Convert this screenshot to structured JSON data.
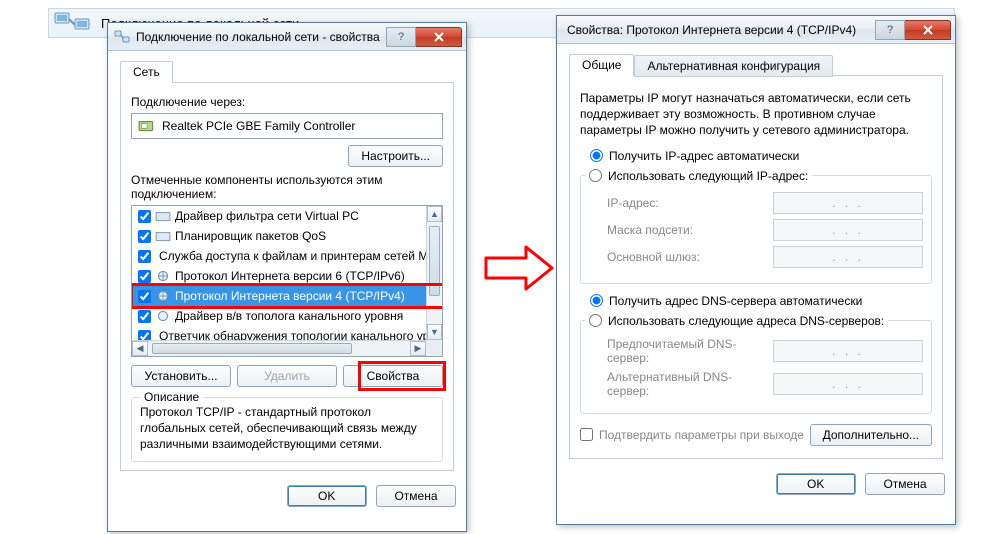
{
  "bg": {
    "label": "Подключение по локальной сети"
  },
  "win1": {
    "title": "Подключение по локальной сети - свойства",
    "tab_network": "Сеть",
    "connect_using_label": "Подключение через:",
    "adapter": "Realtek PCIe GBE Family Controller",
    "configure_btn": "Настроить...",
    "components_label": "Отмеченные компоненты используются этим подключением:",
    "components": [
      "Драйвер фильтра сети Virtual PC",
      "Планировщик пакетов QoS",
      "Служба доступа к файлам и принтерам сетей Micro",
      "Протокол Интернета версии 6 (TCP/IPv6)",
      "Протокол Интернета версии 4 (TCP/IPv4)",
      "Драйвер в/в тополога канального уровня",
      "Ответчик обнаружения топологии канального уров"
    ],
    "install_btn": "Установить...",
    "remove_btn": "Удалить",
    "properties_btn": "Свойства",
    "desc_label": "Описание",
    "desc_text": "Протокол TCP/IP - стандартный протокол глобальных сетей, обеспечивающий связь между различными взаимодействующими сетями.",
    "ok": "OK",
    "cancel": "Отмена"
  },
  "win2": {
    "title": "Свойства: Протокол Интернета версии 4 (TCP/IPv4)",
    "tab_general": "Общие",
    "tab_alt": "Альтернативная конфигурация",
    "intro": "Параметры IP могут назначаться автоматически, если сеть поддерживает эту возможность. В противном случае параметры IP можно получить у сетевого администратора.",
    "ip_auto": "Получить IP-адрес автоматически",
    "ip_manual": "Использовать следующий IP-адрес:",
    "ip_label": "IP-адрес:",
    "mask_label": "Маска подсети:",
    "gateway_label": "Основной шлюз:",
    "dns_auto": "Получить адрес DNS-сервера автоматически",
    "dns_manual": "Использовать следующие адреса DNS-серверов:",
    "dns_pref": "Предпочитаемый DNS-сервер:",
    "dns_alt": "Альтернативный DNS-сервер:",
    "ip_placeholder": ".     .     .",
    "confirm_exit": "Подтвердить параметры при выходе",
    "advanced_btn": "Дополнительно...",
    "ok": "OK",
    "cancel": "Отмена"
  }
}
